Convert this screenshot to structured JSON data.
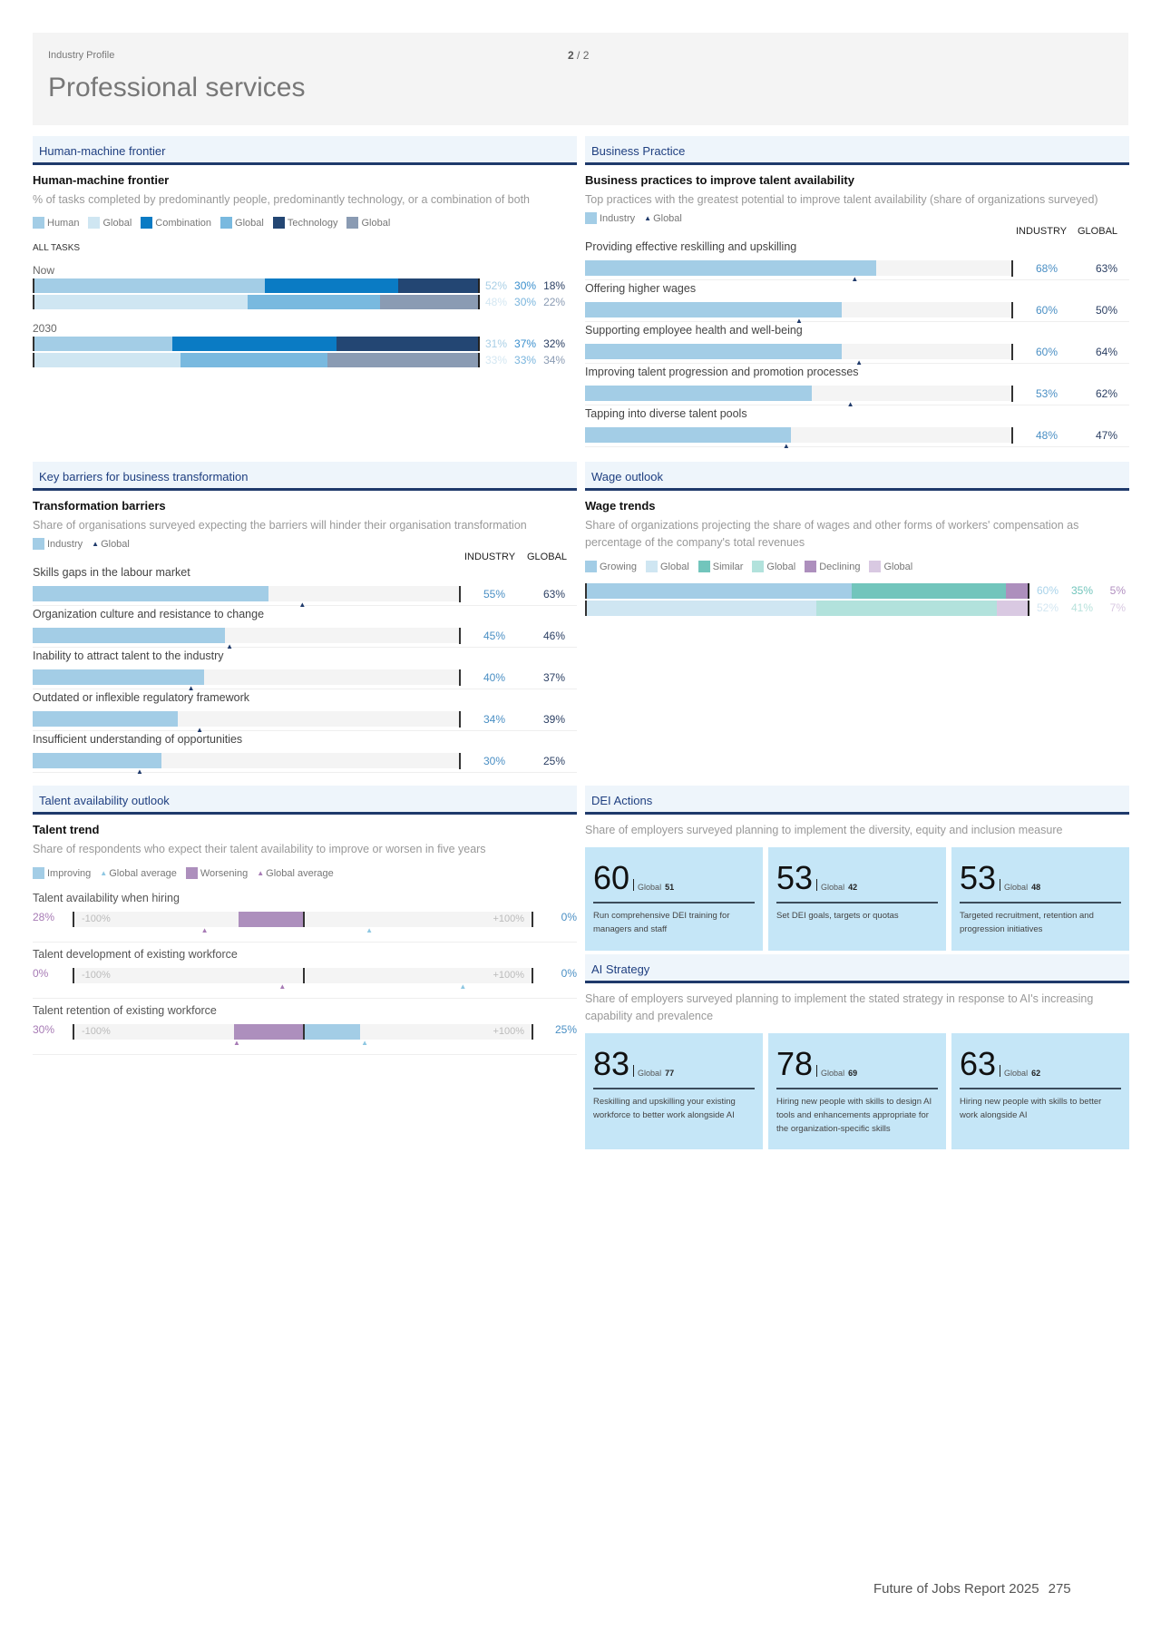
{
  "header": {
    "kicker": "Industry Profile",
    "page_current": "2",
    "page_sep": "/",
    "page_total": "2",
    "title": "Professional services"
  },
  "colors": {
    "accent_navy": "#1f3a6b",
    "industry_bar": "#a3cde6",
    "combination": "#0a7bc4",
    "technology": "#234673",
    "worsening": "#ad8fbd",
    "similar": "#72c5bc"
  },
  "human_machine": {
    "section": "Human-machine frontier",
    "title": "Human-machine frontier",
    "subtitle": "% of tasks completed by predominantly people, predominantly technology, or a combination of both",
    "legend": [
      "Human",
      "Global",
      "Combination",
      "Global",
      "Technology",
      "Global"
    ],
    "all_tasks": "ALL TASKS",
    "periods": [
      {
        "label": "Now",
        "industry": {
          "human": 52,
          "combination": 30,
          "technology": 18
        },
        "global": {
          "human": 48,
          "combination": 30,
          "technology": 22
        },
        "industry_text": [
          "52%",
          "30%",
          "18%"
        ],
        "global_text": [
          "48%",
          "30%",
          "22%"
        ]
      },
      {
        "label": "2030",
        "industry": {
          "human": 31,
          "combination": 37,
          "technology": 32
        },
        "global": {
          "human": 33,
          "combination": 33,
          "technology": 34
        },
        "industry_text": [
          "31%",
          "37%",
          "32%"
        ],
        "global_text": [
          "33%",
          "33%",
          "34%"
        ]
      }
    ]
  },
  "business_practice": {
    "section": "Business Practice",
    "title": "Business practices to improve talent availability",
    "subtitle": "Top practices with the greatest potential to improve talent availability (share of organizations surveyed)",
    "legend_industry": "Industry",
    "legend_global": "Global",
    "col_industry": "INDUSTRY",
    "col_global": "GLOBAL",
    "rows": [
      {
        "label": "Providing effective reskilling and upskilling",
        "industry": 68,
        "global": 63,
        "industry_text": "68%",
        "global_text": "63%"
      },
      {
        "label": "Offering higher wages",
        "industry": 60,
        "global": 50,
        "industry_text": "60%",
        "global_text": "50%"
      },
      {
        "label": "Supporting employee health and well-being",
        "industry": 60,
        "global": 64,
        "industry_text": "60%",
        "global_text": "64%"
      },
      {
        "label": "Improving talent progression and promotion processes",
        "industry": 53,
        "global": 62,
        "industry_text": "53%",
        "global_text": "62%"
      },
      {
        "label": "Tapping into diverse talent pools",
        "industry": 48,
        "global": 47,
        "industry_text": "48%",
        "global_text": "47%"
      }
    ]
  },
  "barriers": {
    "section": "Key barriers for business transformation",
    "title": "Transformation barriers",
    "subtitle": "Share of organisations surveyed expecting the barriers will hinder their organisation transformation",
    "legend_industry": "Industry",
    "legend_global": "Global",
    "col_industry": "INDUSTRY",
    "col_global": "GLOBAL",
    "rows": [
      {
        "label": "Skills gaps in the labour market",
        "industry": 55,
        "global": 63,
        "industry_text": "55%",
        "global_text": "63%"
      },
      {
        "label": "Organization culture and resistance to change",
        "industry": 45,
        "global": 46,
        "industry_text": "45%",
        "global_text": "46%"
      },
      {
        "label": "Inability to attract talent to the industry",
        "industry": 40,
        "global": 37,
        "industry_text": "40%",
        "global_text": "37%"
      },
      {
        "label": "Outdated or inflexible regulatory framework",
        "industry": 34,
        "global": 39,
        "industry_text": "34%",
        "global_text": "39%"
      },
      {
        "label": "Insufficient understanding of opportunities",
        "industry": 30,
        "global": 25,
        "industry_text": "30%",
        "global_text": "25%"
      }
    ]
  },
  "wage": {
    "section": "Wage outlook",
    "title": "Wage trends",
    "subtitle": "Share of organizations projecting the share of wages and other forms of workers' compensation as percentage of the company's total revenues",
    "legend": [
      "Growing",
      "Global",
      "Similar",
      "Global",
      "Declining",
      "Global"
    ],
    "industry": {
      "growing": 60,
      "similar": 35,
      "declining": 5
    },
    "global": {
      "growing": 52,
      "similar": 41,
      "declining": 7
    },
    "industry_text": [
      "60%",
      "35%",
      "5%"
    ],
    "global_text": [
      "52%",
      "41%",
      "7%"
    ]
  },
  "talent": {
    "section": "Talent availability outlook",
    "title": "Talent trend",
    "subtitle": "Share of respondents who expect their talent availability to improve or worsen in five years",
    "legend": [
      "Improving",
      "Global average",
      "Worsening",
      "Global average"
    ],
    "axis_min": "-100%",
    "axis_max": "+100%",
    "rows": [
      {
        "label": "Talent availability when hiring",
        "worsening": 28,
        "improving": 0,
        "global_worsening": 43,
        "global_improving": 29,
        "worsening_text": "28%",
        "improving_text": "0%"
      },
      {
        "label": "Talent development of existing workforce",
        "worsening": 0,
        "improving": 0,
        "global_worsening": 9,
        "global_improving": 70,
        "worsening_text": "0%",
        "improving_text": "0%"
      },
      {
        "label": "Talent retention of existing workforce",
        "worsening": 30,
        "improving": 25,
        "global_worsening": 29,
        "global_improving": 27,
        "worsening_text": "30%",
        "improving_text": "25%"
      }
    ]
  },
  "dei": {
    "section": "DEI Actions",
    "subtitle": "Share of employers surveyed planning to implement the diversity, equity and inclusion measure",
    "global_label": "Global",
    "cards": [
      {
        "value": "60",
        "global": "51",
        "desc": "Run comprehensive DEI training for managers and staff"
      },
      {
        "value": "53",
        "global": "42",
        "desc": "Set DEI goals, targets or quotas"
      },
      {
        "value": "53",
        "global": "48",
        "desc": "Targeted recruitment, retention and progression initiatives"
      }
    ]
  },
  "ai": {
    "section": "AI Strategy",
    "subtitle": "Share of employers surveyed planning to implement the stated strategy in response to AI's increasing capability and prevalence",
    "global_label": "Global",
    "cards": [
      {
        "value": "83",
        "global": "77",
        "desc": "Reskilling and upskilling your existing workforce to better work alongside AI"
      },
      {
        "value": "78",
        "global": "69",
        "desc": "Hiring new people with skills to design AI tools and enhancements appropriate for the organization-specific skills"
      },
      {
        "value": "63",
        "global": "62",
        "desc": "Hiring new people with skills to better work alongside AI"
      }
    ]
  },
  "footer": {
    "report": "Future of Jobs Report 2025",
    "page": "275"
  }
}
